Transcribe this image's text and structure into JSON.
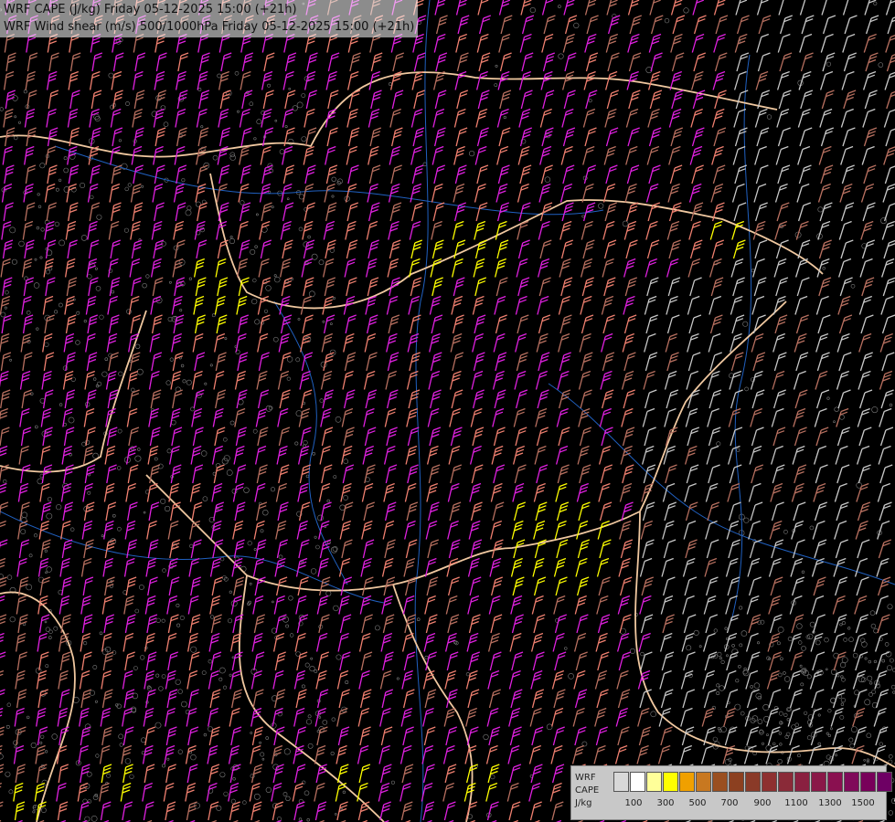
{
  "title": {
    "line1": "WRF CAPE (J/kg) Friday 05-12-2025 15:00 (+21h)",
    "line2": "WRF Wind shear (m/s) 500/1000hPa Friday 05-12-2025 15:00 (+21h)"
  },
  "legend": {
    "title_lines": [
      "WRF",
      "CAPE",
      "J/kg"
    ],
    "colors": [
      "#d8d8d8",
      "#ffffff",
      "#ffff99",
      "#ffff00",
      "#f0a000",
      "#c87820",
      "#9a4f20",
      "#8c4020",
      "#8a3a28",
      "#8e3030",
      "#8a2a38",
      "#8a2040",
      "#8a1848",
      "#8a1050",
      "#800a5a",
      "#78005a",
      "#6e0064"
    ],
    "tick_labels": [
      "100",
      "300",
      "500",
      "700",
      "900",
      "1100",
      "1300",
      "1500"
    ]
  },
  "map": {
    "background": "#000000",
    "barb_colors": {
      "light": "#c8c8c8",
      "brown": "#b87060",
      "salmon": "#f08070",
      "magenta": "#e020e0",
      "yellow": "#ffff00"
    },
    "border_color": "#f0c8a0",
    "river_color": "#2060c0"
  }
}
